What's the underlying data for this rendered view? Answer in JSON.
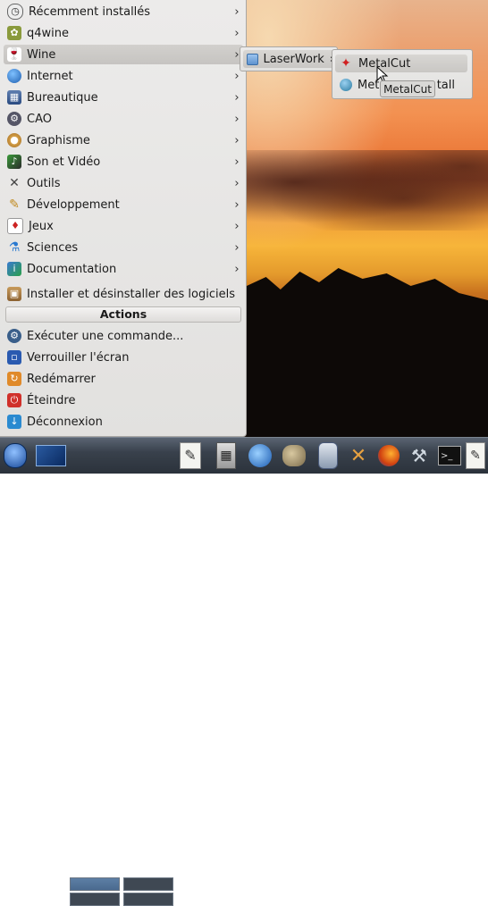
{
  "main_menu": {
    "items": [
      {
        "label": "Récemment installés",
        "icon": "clock-icon"
      },
      {
        "label": "q4wine",
        "icon": "q4wine-icon"
      },
      {
        "label": "Wine",
        "icon": "wine-glass-icon"
      },
      {
        "label": "Internet",
        "icon": "globe-icon"
      },
      {
        "label": "Bureautique",
        "icon": "office-icon"
      },
      {
        "label": "CAO",
        "icon": "cad-icon"
      },
      {
        "label": "Graphisme",
        "icon": "palette-icon"
      },
      {
        "label": "Son et Vidéo",
        "icon": "multimedia-icon"
      },
      {
        "label": "Outils",
        "icon": "tools-icon"
      },
      {
        "label": "Développement",
        "icon": "development-icon"
      },
      {
        "label": "Jeux",
        "icon": "games-icon"
      },
      {
        "label": "Sciences",
        "icon": "science-icon"
      },
      {
        "label": "Documentation",
        "icon": "documentation-icon"
      }
    ],
    "install_label": "Installer et désinstaller des logiciels",
    "actions_header": "Actions",
    "actions": [
      {
        "label": "Exécuter une commande...",
        "icon": "run-command-icon"
      },
      {
        "label": "Verrouiller l'écran",
        "icon": "lock-icon"
      },
      {
        "label": "Redémarrer",
        "icon": "restart-icon"
      },
      {
        "label": "Éteindre",
        "icon": "power-icon"
      },
      {
        "label": "Déconnexion",
        "icon": "logout-icon"
      }
    ]
  },
  "wine_submenu": {
    "items": [
      {
        "label": "LaserWork",
        "icon": "folder-icon"
      }
    ]
  },
  "laserwork_submenu": {
    "items": [
      {
        "label": "MetalCut",
        "icon": "metalcut-icon"
      },
      {
        "label_start": "Met",
        "label_end": "tall",
        "icon": "uninstall-icon"
      }
    ]
  },
  "tooltip": {
    "text": "MetalCut"
  },
  "taskbar": {
    "icons": [
      "start-menu-icon",
      "desktop-icon",
      "pager",
      "text-editor-icon",
      "calculator-icon",
      "thunderbird-icon",
      "gimp-icon",
      "database-icon",
      "tools-icon",
      "firefox-icon",
      "network-icon",
      "terminal-icon",
      "notes-icon"
    ]
  }
}
